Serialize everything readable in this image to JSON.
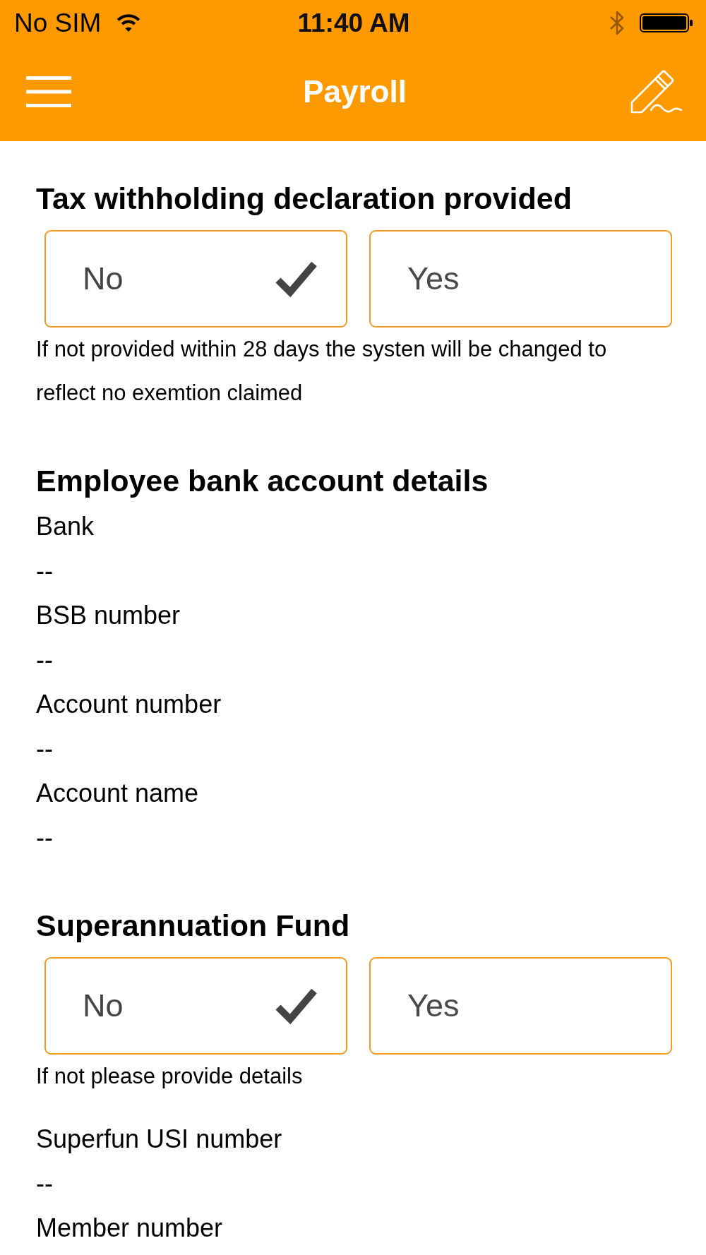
{
  "status_bar": {
    "carrier": "No SIM",
    "time": "11:40 AM"
  },
  "nav_bar": {
    "title": "Payroll"
  },
  "sections": [
    {
      "title": "Tax withholding declaration provided",
      "options": [
        {
          "label": "No",
          "selected": true
        },
        {
          "label": "Yes",
          "selected": false
        }
      ],
      "note": "If not provided within 28 days the systen will be changed to reflect no exemtion claimed"
    },
    {
      "title": "Employee bank account details",
      "fields": [
        {
          "label": "Bank",
          "value": "--"
        },
        {
          "label": "BSB number",
          "value": "--"
        },
        {
          "label": "Account number",
          "value": "--"
        },
        {
          "label": "Account name",
          "value": "--"
        }
      ]
    },
    {
      "title": "Superannuation Fund",
      "options": [
        {
          "label": "No",
          "selected": true
        },
        {
          "label": "Yes",
          "selected": false
        }
      ],
      "note": "If not please provide details",
      "fields": [
        {
          "label": "Superfun USI number",
          "value": "--"
        },
        {
          "label": "Member number"
        }
      ]
    }
  ]
}
